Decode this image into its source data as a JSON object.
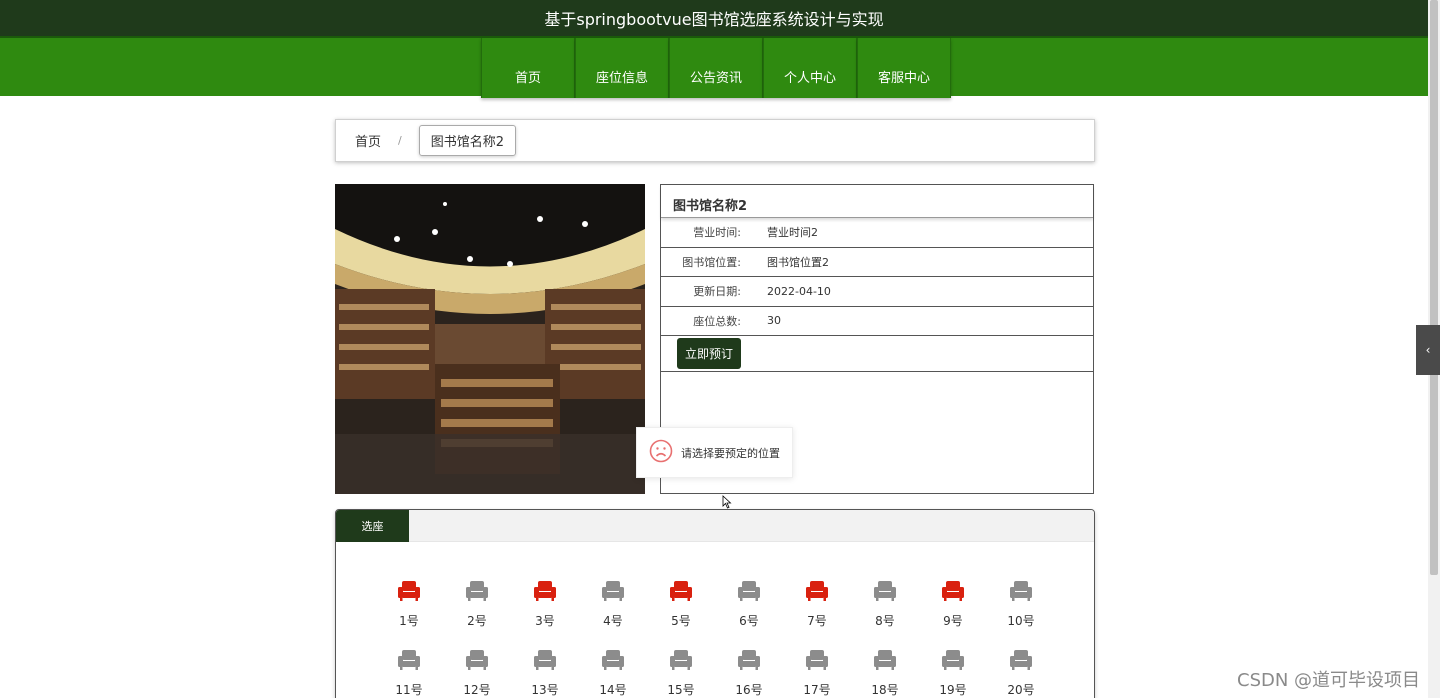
{
  "header": {
    "title": "基于springbootvue图书馆选座系统设计与实现"
  },
  "nav": [
    "首页",
    "座位信息",
    "公告资讯",
    "个人中心",
    "客服中心"
  ],
  "breadcrumb": {
    "home": "首页",
    "separator": "/",
    "current": "图书馆名称2"
  },
  "detail": {
    "title": "图书馆名称2",
    "rows": [
      {
        "key": "营业时间:",
        "value": "营业时间2"
      },
      {
        "key": "图书馆位置:",
        "value": "图书馆位置2"
      },
      {
        "key": "更新日期:",
        "value": "2022-04-10"
      },
      {
        "key": "座位总数:",
        "value": "30"
      }
    ],
    "book_button": "立即预订"
  },
  "toast": {
    "message": "请选择要预定的位置",
    "icon": "sad-face-icon"
  },
  "seats": {
    "tab_label": "选座",
    "list": [
      {
        "label": "1号",
        "status": "occupied"
      },
      {
        "label": "2号",
        "status": "available"
      },
      {
        "label": "3号",
        "status": "occupied"
      },
      {
        "label": "4号",
        "status": "available"
      },
      {
        "label": "5号",
        "status": "occupied"
      },
      {
        "label": "6号",
        "status": "available"
      },
      {
        "label": "7号",
        "status": "occupied"
      },
      {
        "label": "8号",
        "status": "available"
      },
      {
        "label": "9号",
        "status": "occupied"
      },
      {
        "label": "10号",
        "status": "available"
      },
      {
        "label": "11号",
        "status": "available"
      },
      {
        "label": "12号",
        "status": "available"
      },
      {
        "label": "13号",
        "status": "available"
      },
      {
        "label": "14号",
        "status": "available"
      },
      {
        "label": "15号",
        "status": "available"
      },
      {
        "label": "16号",
        "status": "available"
      },
      {
        "label": "17号",
        "status": "available"
      },
      {
        "label": "18号",
        "status": "available"
      },
      {
        "label": "19号",
        "status": "available"
      },
      {
        "label": "20号",
        "status": "available"
      }
    ]
  },
  "colors": {
    "header_bg": "#1f3a1b",
    "nav_bg": "#2f8a10",
    "occupied": "#d9210f",
    "available": "#8c8c8c",
    "button_bg": "#1f3a1b"
  },
  "watermark": "CSDN @道可毕设项目"
}
